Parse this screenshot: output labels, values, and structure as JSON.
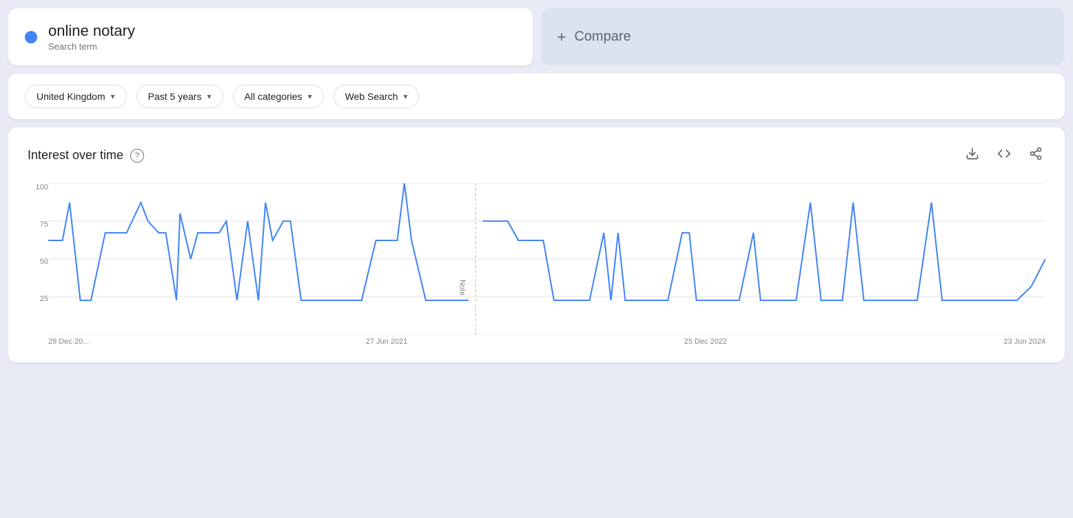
{
  "search": {
    "title": "online notary",
    "subtitle": "Search term",
    "dot_color": "#4285f4"
  },
  "compare": {
    "plus": "+",
    "label": "Compare"
  },
  "filters": [
    {
      "id": "region",
      "label": "United Kingdom",
      "chevron": "▾"
    },
    {
      "id": "time",
      "label": "Past 5 years",
      "chevron": "▾"
    },
    {
      "id": "category",
      "label": "All categories",
      "chevron": "▾"
    },
    {
      "id": "search_type",
      "label": "Web Search",
      "chevron": "▾"
    }
  ],
  "chart": {
    "title": "Interest over time",
    "help": "?",
    "actions": {
      "download": "⬇",
      "embed": "<>",
      "share": "↗"
    },
    "y_labels": [
      "100",
      "75",
      "50",
      "25",
      ""
    ],
    "x_labels": [
      "29 Dec 20...",
      "27 Jun 2021",
      "25 Dec 2022",
      "23 Jun 2024"
    ],
    "note_label": "Note"
  }
}
